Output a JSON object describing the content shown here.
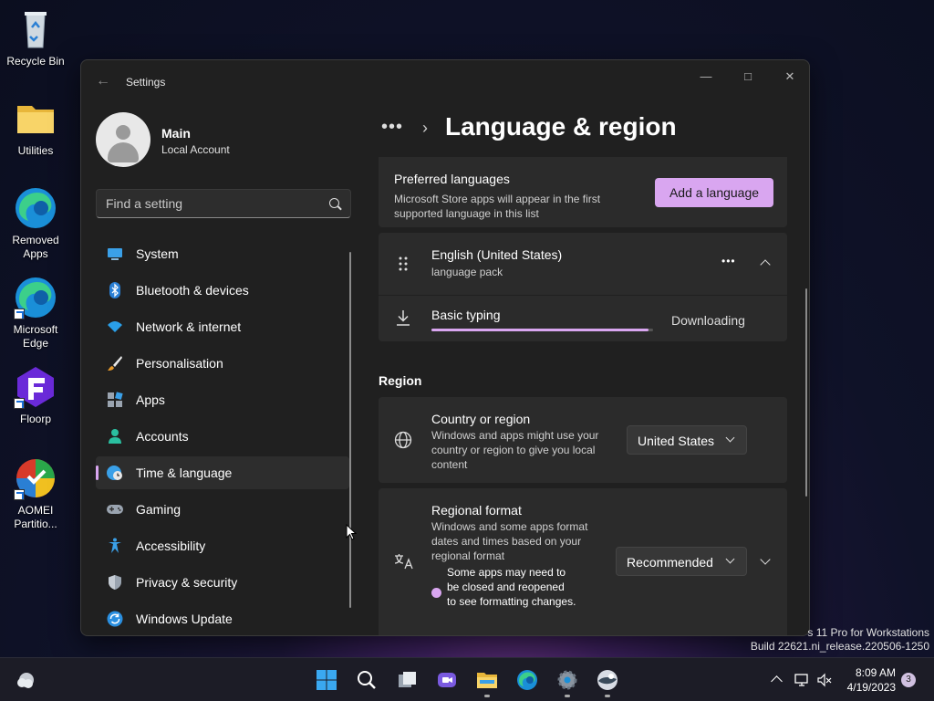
{
  "desktop": {
    "icons": [
      {
        "label": "Recycle Bin"
      },
      {
        "label": "Utilities"
      },
      {
        "label": "Removed Apps"
      },
      {
        "label": "Microsoft Edge"
      },
      {
        "label": "Floorp"
      },
      {
        "label": "AOMEI Partitio..."
      }
    ]
  },
  "window": {
    "title": "Settings",
    "profile": {
      "name": "Main",
      "type": "Local Account"
    },
    "search": {
      "placeholder": "Find a setting"
    },
    "nav": [
      {
        "label": "System",
        "icon": "monitor-icon"
      },
      {
        "label": "Bluetooth & devices",
        "icon": "bluetooth-icon"
      },
      {
        "label": "Network & internet",
        "icon": "wifi-icon"
      },
      {
        "label": "Personalisation",
        "icon": "brush-icon"
      },
      {
        "label": "Apps",
        "icon": "apps-icon"
      },
      {
        "label": "Accounts",
        "icon": "person-icon"
      },
      {
        "label": "Time & language",
        "icon": "globe-clock-icon",
        "active": true
      },
      {
        "label": "Gaming",
        "icon": "gamepad-icon"
      },
      {
        "label": "Accessibility",
        "icon": "accessibility-icon"
      },
      {
        "label": "Privacy & security",
        "icon": "shield-icon"
      },
      {
        "label": "Windows Update",
        "icon": "update-icon"
      }
    ],
    "breadcrumb": {
      "more": "•••",
      "separator": ">"
    },
    "page_title": "Language & region",
    "preferred": {
      "title": "Preferred languages",
      "desc": "Microsoft Store apps will appear in the first supported language in this list",
      "button": "Add a language"
    },
    "language": {
      "name": "English (United States)",
      "sub": "language pack",
      "more": "•••"
    },
    "basic_typing": {
      "label": "Basic typing",
      "status": "Downloading",
      "progress": 0.98
    },
    "region_heading": "Region",
    "country": {
      "title": "Country or region",
      "desc": "Windows and apps might use your country or region to give you local content",
      "value": "United States"
    },
    "regional_format": {
      "title": "Regional format",
      "desc": "Windows and some apps format dates and times based on your regional format",
      "note": "Some apps may need to be closed and reopened to see formatting changes.",
      "value": "Recommended"
    },
    "accent": "#d9a6f0"
  },
  "watermark": {
    "line1": "s 11 Pro for Workstations",
    "line2": "Build 22621.ni_release.220506-1250"
  },
  "taskbar": {
    "time": "8:09 AM",
    "date": "4/19/2023",
    "notifications": "3"
  }
}
